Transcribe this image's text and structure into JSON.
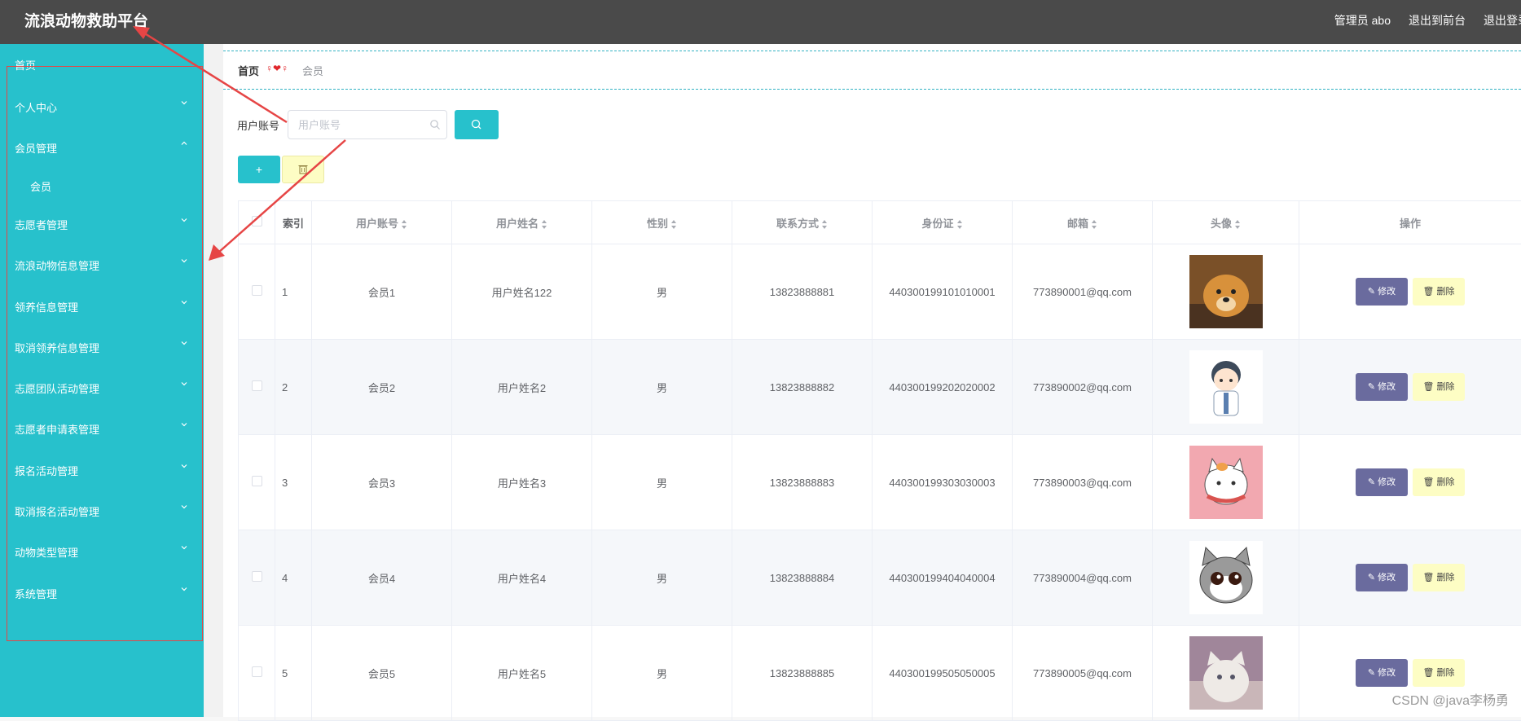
{
  "header": {
    "title": "流浪动物救助平台",
    "admin": "管理员 abo",
    "to_front": "退出到前台",
    "logout": "退出登录"
  },
  "sidebar": {
    "items": [
      {
        "label": "首页",
        "chev": ""
      },
      {
        "label": "个人中心",
        "chev": "down"
      },
      {
        "label": "会员管理",
        "chev": "up"
      },
      {
        "label": "会员",
        "chev": "",
        "sub": true
      },
      {
        "label": "志愿者管理",
        "chev": "down"
      },
      {
        "label": "流浪动物信息管理",
        "chev": "down"
      },
      {
        "label": "领养信息管理",
        "chev": "down"
      },
      {
        "label": "取消领养信息管理",
        "chev": "down"
      },
      {
        "label": "志愿团队活动管理",
        "chev": "down"
      },
      {
        "label": "志愿者申请表管理",
        "chev": "down"
      },
      {
        "label": "报名活动管理",
        "chev": "down"
      },
      {
        "label": "取消报名活动管理",
        "chev": "down"
      },
      {
        "label": "动物类型管理",
        "chev": "down"
      },
      {
        "label": "系统管理",
        "chev": "down"
      }
    ]
  },
  "breadcrumb": {
    "home": "首页",
    "sep": "♀❤♀",
    "current": "会员"
  },
  "search": {
    "label": "用户账号",
    "placeholder": "用户账号"
  },
  "buttons": {
    "add": "+",
    "edit": "修改",
    "delete": "删除"
  },
  "table": {
    "columns": [
      "索引",
      "用户账号",
      "用户姓名",
      "性别",
      "联系方式",
      "身份证",
      "邮箱",
      "头像",
      "操作"
    ],
    "rows": [
      {
        "idx": "1",
        "account": "会员1",
        "name": "用户姓名122",
        "gender": "男",
        "phone": "13823888881",
        "id_card": "440300199101010001",
        "email": "773890001@qq.com",
        "avatar": "dog-photo"
      },
      {
        "idx": "2",
        "account": "会员2",
        "name": "用户姓名2",
        "gender": "男",
        "phone": "13823888882",
        "id_card": "440300199202020002",
        "email": "773890002@qq.com",
        "avatar": "cartoon-boy"
      },
      {
        "idx": "3",
        "account": "会员3",
        "name": "用户姓名3",
        "gender": "男",
        "phone": "13823888883",
        "id_card": "440300199303030003",
        "email": "773890003@qq.com",
        "avatar": "cartoon-cat-pink"
      },
      {
        "idx": "4",
        "account": "会员4",
        "name": "用户姓名4",
        "gender": "男",
        "phone": "13823888884",
        "id_card": "440300199404040004",
        "email": "773890004@qq.com",
        "avatar": "cartoon-cat-tabby"
      },
      {
        "idx": "5",
        "account": "会员5",
        "name": "用户姓名5",
        "gender": "男",
        "phone": "13823888885",
        "id_card": "440300199505050005",
        "email": "773890005@qq.com",
        "avatar": "cat-photo"
      }
    ]
  },
  "watermark": "CSDN @java李杨勇",
  "colors": {
    "topbar": "#4a4a4a",
    "sidebar": "#27c1cc",
    "accent": "#27c1cc",
    "edit": "#6a6b9e",
    "delete": "#fdfdc4",
    "annotation": "#e64545"
  }
}
